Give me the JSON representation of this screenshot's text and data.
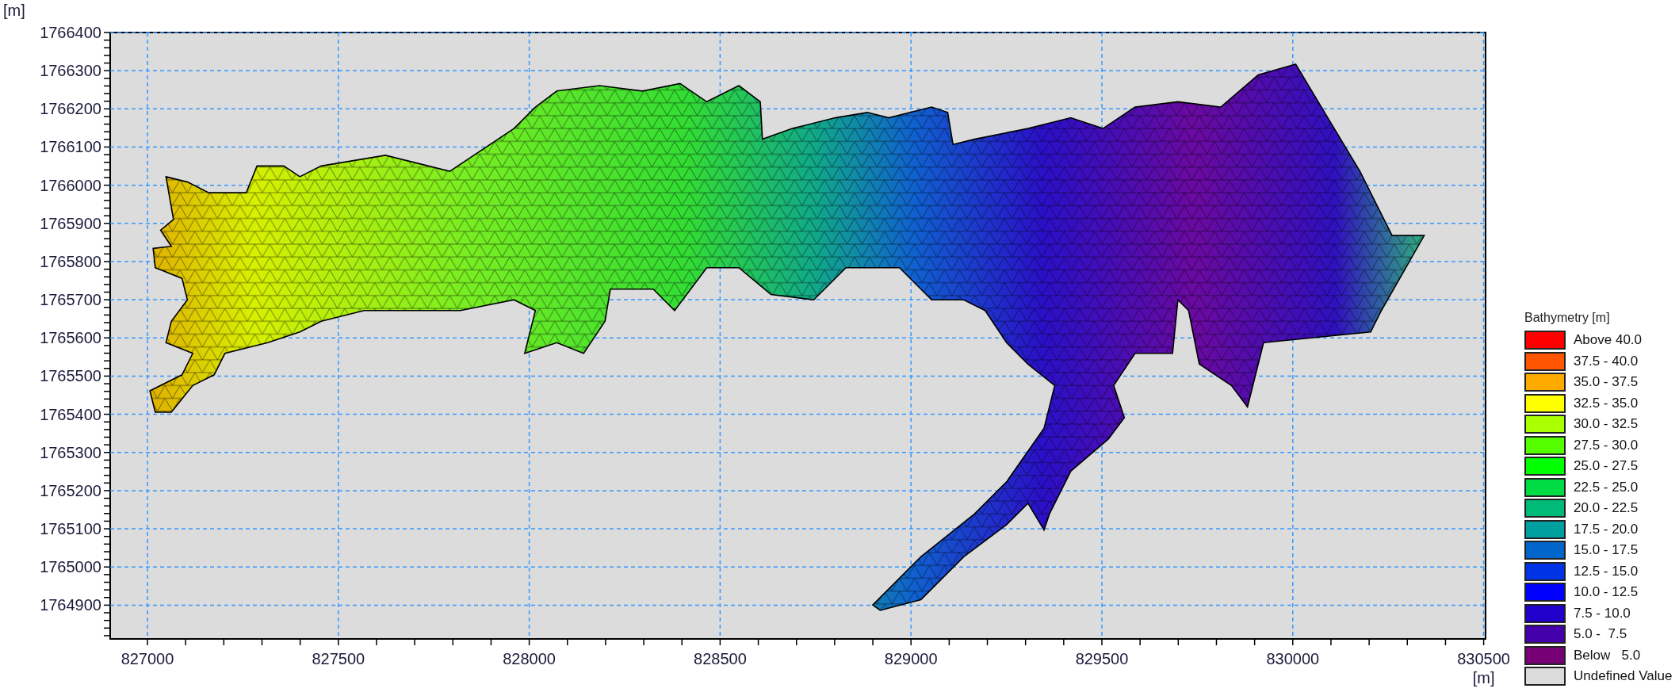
{
  "y_axis": {
    "unit": "[m]",
    "ticks": [
      "1766400",
      "1766300",
      "1766200",
      "1766100",
      "1766000",
      "1765900",
      "1765800",
      "1765700",
      "1765600",
      "1765500",
      "1765400",
      "1765300",
      "1765200",
      "1765100",
      "1765000",
      "1764900"
    ]
  },
  "x_axis": {
    "unit": "[m]",
    "ticks": [
      "827000",
      "827500",
      "828000",
      "828500",
      "829000",
      "829500",
      "830000",
      "830500"
    ]
  },
  "legend": {
    "title": "Bathymetry [m]",
    "items": [
      {
        "label": "Above 40.0",
        "color": "#ff0000"
      },
      {
        "label": "37.5 - 40.0",
        "color": "#ff5500"
      },
      {
        "label": "35.0 - 37.5",
        "color": "#ffaa00"
      },
      {
        "label": "32.5 - 35.0",
        "color": "#ffff00"
      },
      {
        "label": "30.0 - 32.5",
        "color": "#aaff00"
      },
      {
        "label": "27.5 - 30.0",
        "color": "#55ff00"
      },
      {
        "label": "25.0 - 27.5",
        "color": "#00ff00"
      },
      {
        "label": "22.5 - 25.0",
        "color": "#00dd44"
      },
      {
        "label": "20.0 - 22.5",
        "color": "#00bb77"
      },
      {
        "label": "17.5 - 20.0",
        "color": "#00a0a0"
      },
      {
        "label": "15.0 - 17.5",
        "color": "#0066cc"
      },
      {
        "label": "12.5 - 15.0",
        "color": "#0033e6"
      },
      {
        "label": "10.0 - 12.5",
        "color": "#0000ff"
      },
      {
        "label": "7.5 - 10.0",
        "color": "#2200cc"
      },
      {
        "label": "5.0 -  7.5",
        "color": "#4400aa"
      },
      {
        "label": "Below   5.0",
        "color": "#770077"
      },
      {
        "label": "Undefined Value",
        "color": "#dcdcdc"
      }
    ]
  }
}
